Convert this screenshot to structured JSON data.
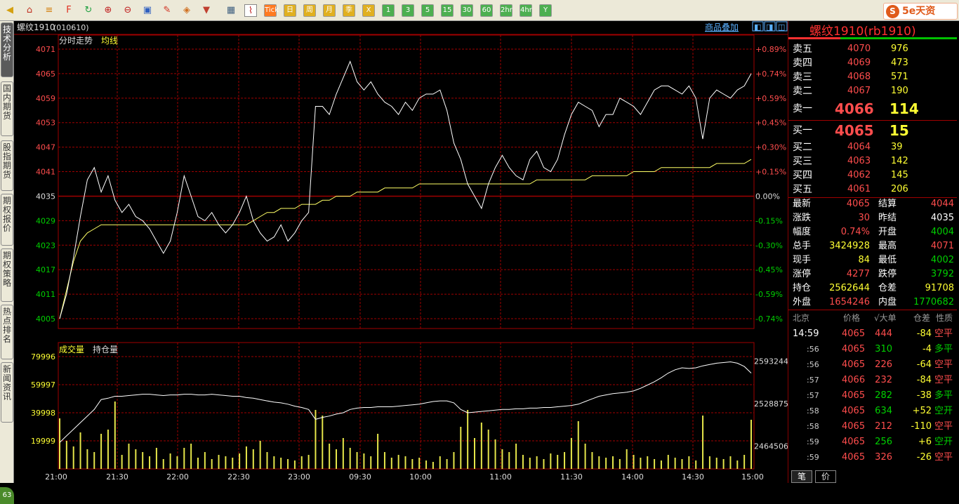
{
  "toolbar": {
    "text_buttons": [
      {
        "label": "Tick",
        "color": "#ff7a20"
      },
      {
        "label": "日",
        "color": "#e0b020"
      },
      {
        "label": "周",
        "color": "#e0b020"
      },
      {
        "label": "月",
        "color": "#e0b020"
      },
      {
        "label": "季",
        "color": "#e0b020"
      },
      {
        "label": "X",
        "color": "#e0b020"
      },
      {
        "label": "1",
        "color": "#4caf50"
      },
      {
        "label": "3",
        "color": "#4caf50"
      },
      {
        "label": "5",
        "color": "#4caf50"
      },
      {
        "label": "15",
        "color": "#4caf50"
      },
      {
        "label": "30",
        "color": "#4caf50"
      },
      {
        "label": "60",
        "color": "#4caf50"
      },
      {
        "label": "2hr",
        "color": "#4caf50"
      },
      {
        "label": "4hr",
        "color": "#4caf50"
      },
      {
        "label": "Y",
        "color": "#4caf50"
      }
    ],
    "icons": [
      "back-icon",
      "home-icon",
      "stack-icon",
      "f10-icon",
      "refresh-icon",
      "zoom-in-icon",
      "zoom-out-icon",
      "windows-icon",
      "pen-icon",
      "paint-icon",
      "filter-icon",
      "table-icon",
      "chart-icon"
    ],
    "brand": "5e天资"
  },
  "sidebar": {
    "tabs": [
      "技术分析",
      "国内期货",
      "股指期货",
      "期权报价",
      "期权策略",
      "热点排名",
      "新闻资讯"
    ],
    "corner": "63"
  },
  "header": {
    "title": "螺纹1910",
    "code": "(010610)",
    "overlay_link": "商品叠加"
  },
  "chart_labels": {
    "price_panel": "分时走势",
    "avg_line": "均线",
    "vol_panel": "成交量",
    "oi_panel": "持仓量"
  },
  "chart_data": {
    "type": "line",
    "x_ticks": [
      "21:00",
      "21:30",
      "22:00",
      "22:30",
      "23:00",
      "09:30",
      "10:00",
      "11:00",
      "11:30",
      "14:00",
      "14:30",
      "15:00"
    ],
    "price_ticks": [
      "4071",
      "4065",
      "4059",
      "4053",
      "4047",
      "4041",
      "4035",
      "4029",
      "4023",
      "4017",
      "4011",
      "4005"
    ],
    "pct_ticks": [
      "+0.89%",
      "+0.74%",
      "+0.59%",
      "+0.45%",
      "+0.30%",
      "+0.15%",
      "0.00%",
      "-0.15%",
      "-0.30%",
      "-0.45%",
      "-0.59%",
      "-0.74%"
    ],
    "ylim": [
      4005,
      4071
    ],
    "prev_settle": 4035,
    "price_series": [
      4005,
      4011,
      4020,
      4030,
      4039,
      4042,
      4036,
      4040,
      4034,
      4031,
      4033,
      4030,
      4029,
      4027,
      4024,
      4021,
      4024,
      4031,
      4040,
      4035,
      4030,
      4029,
      4031,
      4028,
      4026,
      4028,
      4031,
      4035,
      4029,
      4026,
      4024,
      4025,
      4028,
      4024,
      4026,
      4029,
      4031,
      4057,
      4057,
      4055,
      4060,
      4064,
      4068,
      4063,
      4061,
      4063,
      4060,
      4058,
      4057,
      4055,
      4058,
      4056,
      4059,
      4060,
      4060,
      4061,
      4056,
      4048,
      4044,
      4038,
      4035,
      4032,
      4038,
      4042,
      4045,
      4042,
      4040,
      4039,
      4044,
      4046,
      4042,
      4041,
      4044,
      4050,
      4055,
      4058,
      4057,
      4056,
      4052,
      4055,
      4055,
      4059,
      4058,
      4057,
      4055,
      4058,
      4061,
      4062,
      4062,
      4061,
      4060,
      4062,
      4059,
      4049,
      4059,
      4061,
      4060,
      4059,
      4061,
      4062,
      4065
    ],
    "avg_series": [
      4005,
      4012,
      4019,
      4024,
      4026,
      4027,
      4028,
      4028,
      4028,
      4028,
      4028,
      4028,
      4028,
      4028,
      4028,
      4028,
      4028,
      4028,
      4028,
      4028,
      4028,
      4028,
      4028,
      4028,
      4028,
      4028,
      4028,
      4028,
      4029,
      4030,
      4031,
      4031,
      4032,
      4032,
      4032,
      4033,
      4033,
      4033,
      4034,
      4034,
      4035,
      4035,
      4035,
      4036,
      4036,
      4036,
      4036,
      4037,
      4037,
      4037,
      4037,
      4037,
      4038,
      4038,
      4038,
      4038,
      4038,
      4038,
      4038,
      4038,
      4038,
      4038,
      4038,
      4038,
      4038,
      4038,
      4038,
      4038,
      4038,
      4039,
      4039,
      4039,
      4039,
      4039,
      4039,
      4039,
      4039,
      4040,
      4040,
      4040,
      4040,
      4040,
      4040,
      4041,
      4041,
      4041,
      4041,
      4042,
      4042,
      4042,
      4042,
      4042,
      4042,
      4042,
      4042,
      4043,
      4043,
      4043,
      4043,
      4043,
      4044
    ],
    "vol_ticks": [
      "79996",
      "59997",
      "39998",
      "19999"
    ],
    "vol_ylim": [
      0,
      80000
    ],
    "oi_ticks": [
      "2593244",
      "2528875",
      "2464506"
    ],
    "oi_ylim": [
      2430000,
      2600000
    ],
    "volume_series": [
      36000,
      20000,
      16000,
      26000,
      14000,
      12000,
      25000,
      28000,
      48000,
      10000,
      18000,
      14000,
      12000,
      9000,
      15000,
      7000,
      11000,
      9000,
      15000,
      18000,
      8000,
      12000,
      7000,
      10000,
      9000,
      8000,
      11000,
      16000,
      14000,
      20000,
      12000,
      9000,
      8000,
      7000,
      6000,
      9000,
      10000,
      42000,
      38000,
      18000,
      14000,
      22000,
      15000,
      12000,
      11000,
      9000,
      25000,
      12000,
      8000,
      10000,
      9000,
      7000,
      8000,
      6000,
      5000,
      9000,
      7000,
      12000,
      30000,
      42000,
      22000,
      33000,
      28000,
      21000,
      14000,
      12000,
      18000,
      10000,
      8000,
      9000,
      7000,
      11000,
      10000,
      12000,
      22000,
      34000,
      18000,
      12000,
      9000,
      8000,
      9000,
      7000,
      14000,
      10000,
      8000,
      9000,
      7000,
      6000,
      10000,
      8000,
      7000,
      9000,
      6000,
      38000,
      9000,
      8000,
      7000,
      9000,
      6000,
      10000,
      35000
    ],
    "oi_series": [
      2470000,
      2480000,
      2490000,
      2500000,
      2510000,
      2520000,
      2535000,
      2537000,
      2540000,
      2540000,
      2541000,
      2542000,
      2543000,
      2543000,
      2542000,
      2541000,
      2542000,
      2542000,
      2543000,
      2543000,
      2542000,
      2542000,
      2543000,
      2542000,
      2541000,
      2540000,
      2540000,
      2538000,
      2537000,
      2535000,
      2533000,
      2531000,
      2530000,
      2528000,
      2525000,
      2523000,
      2520000,
      2505000,
      2508000,
      2510000,
      2513000,
      2515000,
      2520000,
      2522000,
      2523000,
      2523000,
      2524000,
      2524000,
      2524000,
      2525000,
      2526000,
      2527000,
      2528000,
      2530000,
      2532000,
      2533000,
      2533000,
      2530000,
      2520000,
      2515000,
      2516000,
      2517000,
      2518000,
      2519000,
      2520000,
      2520000,
      2521000,
      2521000,
      2522000,
      2522000,
      2523000,
      2523000,
      2524000,
      2525000,
      2526000,
      2528000,
      2532000,
      2536000,
      2540000,
      2542000,
      2544000,
      2545000,
      2546000,
      2548000,
      2552000,
      2557000,
      2562000,
      2568000,
      2575000,
      2580000,
      2583000,
      2582000,
      2583000,
      2586000,
      2588000,
      2590000,
      2591000,
      2592000,
      2590000,
      2585000,
      2575000
    ]
  },
  "quote": {
    "symbol": "螺纹1910(rb1910)",
    "asks": [
      {
        "label": "卖五",
        "price": "4070",
        "vol": "976"
      },
      {
        "label": "卖四",
        "price": "4069",
        "vol": "473"
      },
      {
        "label": "卖三",
        "price": "4068",
        "vol": "571"
      },
      {
        "label": "卖二",
        "price": "4067",
        "vol": "190"
      },
      {
        "label": "卖一",
        "price": "4066",
        "vol": "114"
      }
    ],
    "bids": [
      {
        "label": "买一",
        "price": "4065",
        "vol": "15"
      },
      {
        "label": "买二",
        "price": "4064",
        "vol": "39"
      },
      {
        "label": "买三",
        "price": "4063",
        "vol": "142"
      },
      {
        "label": "买四",
        "price": "4062",
        "vol": "145"
      },
      {
        "label": "买五",
        "price": "4061",
        "vol": "206"
      }
    ],
    "stats": [
      {
        "l1": "最新",
        "v1": "4065",
        "c1": "red",
        "l2": "结算",
        "v2": "4044",
        "c2": "red"
      },
      {
        "l1": "涨跌",
        "v1": "30",
        "c1": "red",
        "l2": "昨结",
        "v2": "4035",
        "c2": "wht"
      },
      {
        "l1": "幅度",
        "v1": "0.74%",
        "c1": "red",
        "l2": "开盘",
        "v2": "4004",
        "c2": "grn"
      },
      {
        "l1": "总手",
        "v1": "3424928",
        "c1": "yel",
        "l2": "最高",
        "v2": "4071",
        "c2": "red"
      },
      {
        "l1": "现手",
        "v1": "84",
        "c1": "yel",
        "l2": "最低",
        "v2": "4002",
        "c2": "grn"
      },
      {
        "l1": "涨停",
        "v1": "4277",
        "c1": "red",
        "l2": "跌停",
        "v2": "3792",
        "c2": "grn"
      },
      {
        "l1": "持仓",
        "v1": "2562644",
        "c1": "yel",
        "l2": "仓差",
        "v2": "91708",
        "c2": "yel"
      },
      {
        "l1": "外盘",
        "v1": "1654246",
        "c1": "red",
        "l2": "内盘",
        "v2": "1770682",
        "c2": "grn"
      }
    ]
  },
  "ticks": {
    "header": {
      "loc": "北京",
      "price": "价格",
      "vol": "√大单",
      "oi": "仓差",
      "nature": "性质"
    },
    "rows": [
      {
        "time": "14:59",
        "price": "4065",
        "vol": "444",
        "vc": "red",
        "oi": "-84",
        "oc": "yel",
        "nature": "空平",
        "nc": "red"
      },
      {
        "time": ":56",
        "price": "4065",
        "vol": "310",
        "vc": "grn",
        "oi": "-4",
        "oc": "yel",
        "nature": "多平",
        "nc": "grn"
      },
      {
        "time": ":56",
        "price": "4065",
        "vol": "226",
        "vc": "red",
        "oi": "-64",
        "oc": "yel",
        "nature": "空平",
        "nc": "red"
      },
      {
        "time": ":57",
        "price": "4066",
        "vol": "232",
        "vc": "red",
        "oi": "-84",
        "oc": "yel",
        "nature": "空平",
        "nc": "red"
      },
      {
        "time": ":57",
        "price": "4065",
        "vol": "282",
        "vc": "grn",
        "oi": "-38",
        "oc": "yel",
        "nature": "多平",
        "nc": "grn"
      },
      {
        "time": ":58",
        "price": "4065",
        "vol": "634",
        "vc": "grn",
        "oi": "+52",
        "oc": "yel",
        "nature": "空开",
        "nc": "grn"
      },
      {
        "time": ":58",
        "price": "4065",
        "vol": "212",
        "vc": "red",
        "oi": "-110",
        "oc": "yel",
        "nature": "空平",
        "nc": "red"
      },
      {
        "time": ":59",
        "price": "4065",
        "vol": "256",
        "vc": "grn",
        "oi": "+6",
        "oc": "yel",
        "nature": "空开",
        "nc": "grn"
      },
      {
        "time": ":59",
        "price": "4065",
        "vol": "326",
        "vc": "red",
        "oi": "-26",
        "oc": "yel",
        "nature": "空平",
        "nc": "red"
      }
    ]
  },
  "bottom_tabs": [
    "笔",
    "价"
  ]
}
